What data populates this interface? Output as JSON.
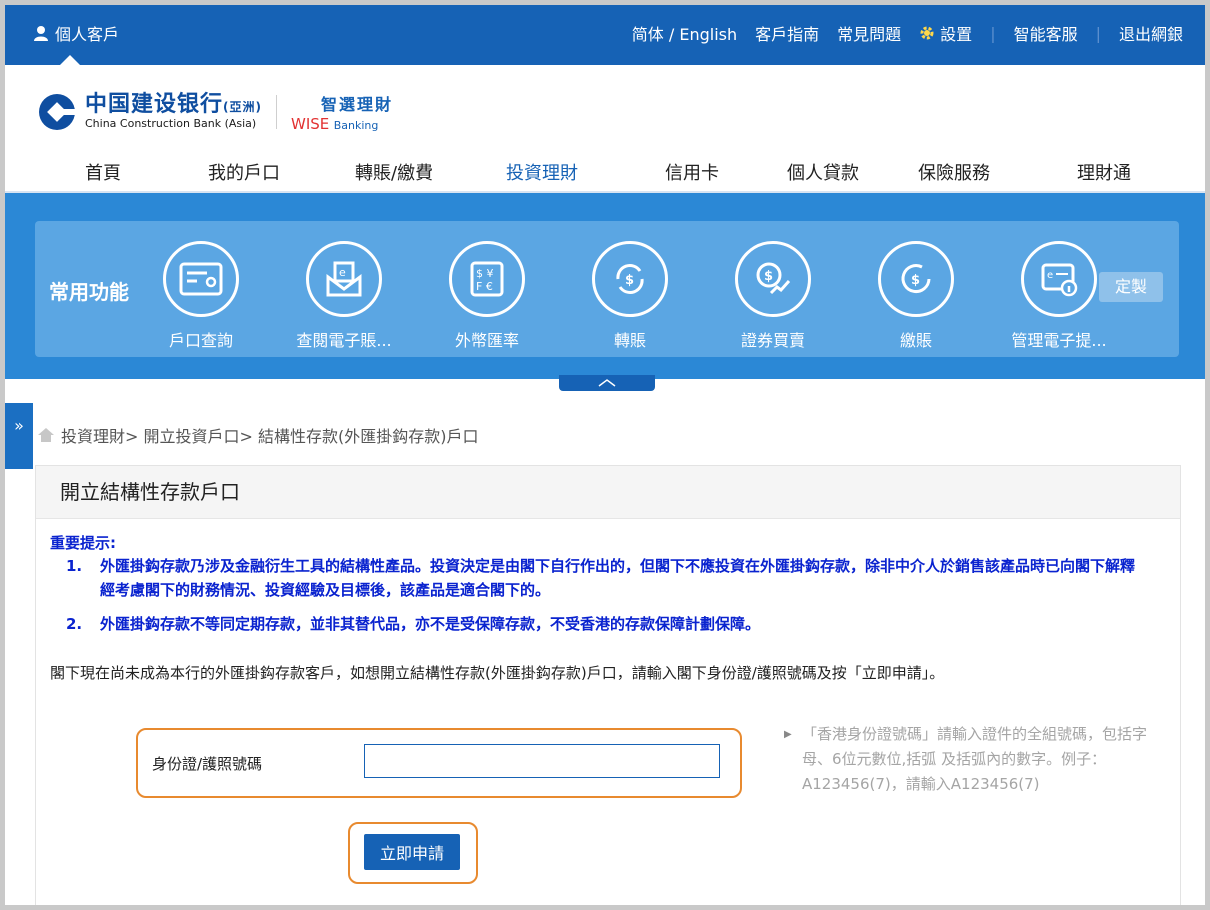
{
  "topbar": {
    "personal": "個人客戶",
    "links": [
      "简体 / English",
      "客戶指南",
      "常見問題",
      "設置",
      "智能客服",
      "退出網銀"
    ]
  },
  "logo": {
    "cn": "中国建设银行",
    "cn_suffix": "(亞洲)",
    "en": "China Construction Bank (Asia)",
    "wise_cn": "智選理財",
    "wise_en": "WISE",
    "wise_en2": "Banking"
  },
  "nav": {
    "items": [
      "首頁",
      "我的戶口",
      "轉賬/繳費",
      "投資理財",
      "信用卡",
      "個人貸款",
      "保險服務",
      "理財通"
    ],
    "active_index": 3
  },
  "quick": {
    "title": "常用功能",
    "items": [
      {
        "label": "戶口查詢",
        "icon": "account-card-icon"
      },
      {
        "label": "查閱電子賬...",
        "icon": "e-statement-icon"
      },
      {
        "label": "外幣匯率",
        "icon": "currency-exchange-icon"
      },
      {
        "label": "轉賬",
        "icon": "transfer-icon"
      },
      {
        "label": "證券買賣",
        "icon": "securities-trading-icon"
      },
      {
        "label": "繳賬",
        "icon": "bill-payment-icon"
      },
      {
        "label": "管理電子提...",
        "icon": "e-notification-icon"
      }
    ],
    "custom_label": "定製"
  },
  "breadcrumb": "投資理財> 開立投資戶口> 結構性存款(外匯掛鈎存款)戶口",
  "page": {
    "title": "開立結構性存款戶口",
    "notice_title": "重要提示:",
    "notices": [
      {
        "idx": "1.",
        "text": "外匯掛鈎存款乃涉及金融衍生工具的結構性產品。投資決定是由閣下自行作出的，但閣下不應投資在外匯掛鈎存款，除非中介人於銷售該產品時已向閣下解釋經考慮閣下的財務情況、投資經驗及目標後，該產品是適合閣下的。"
      },
      {
        "idx": "2.",
        "text": "外匯掛鈎存款不等同定期存款，並非其替代品，亦不是受保障存款，不受香港的存款保障計劃保障。"
      }
    ],
    "intro": "閣下現在尚未成為本行的外匯掛鈎存款客戶，如想開立結構性存款(外匯掛鈎存款)戶口，請輸入閣下身份證/護照號碼及按「立即申請」。",
    "id_label": "身份證/護照號碼",
    "id_value": "",
    "hint": "「香港身份證號碼」請輸入證件的全組號碼，包括字母、6位元數位,括弧 及括弧內的數字。例子：A123456(7)，請輸入A123456(7)",
    "apply_label": "立即申請"
  },
  "colors": {
    "primary": "#1662b5",
    "banner": "#2b88d6",
    "panel": "#5ba6e3",
    "notice": "#0a23cf",
    "highlight": "#e88a2f"
  }
}
